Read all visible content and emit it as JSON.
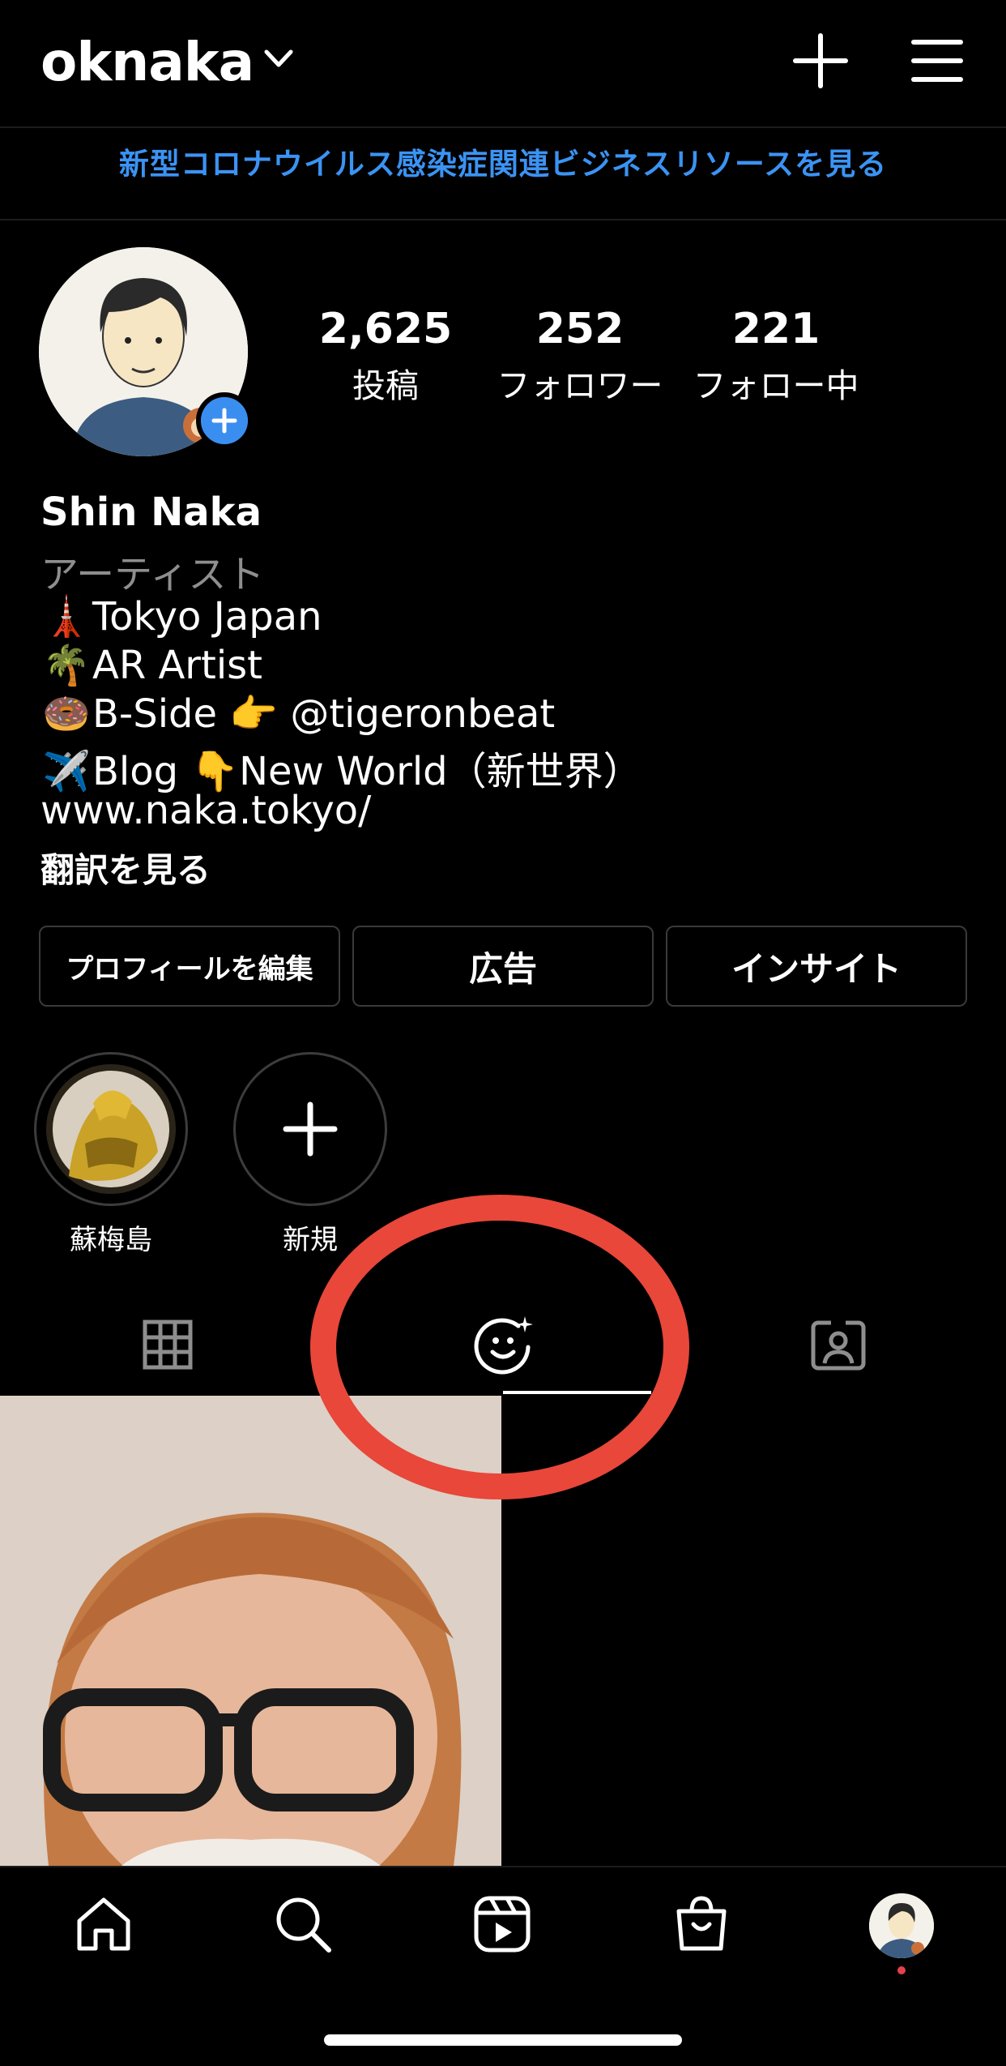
{
  "header": {
    "username": "oknaka",
    "banner": "新型コロナウイルス感染症関連ビジネスリソースを見る"
  },
  "stats": [
    {
      "value": "2,625",
      "label": "投稿"
    },
    {
      "value": "252",
      "label": "フォロワー"
    },
    {
      "value": "221",
      "label": "フォロー中"
    }
  ],
  "bio": {
    "name": "Shin Naka",
    "category": "アーティスト",
    "lines": [
      {
        "emoji": "🗼",
        "text": "Tokyo Japan"
      },
      {
        "emoji": "🌴",
        "text": "AR Artist"
      },
      {
        "emoji": "🍩",
        "text": "B-Side 👉 @tigeronbeat"
      },
      {
        "emoji": "✈️",
        "text": "Blog 👇New World（新世界）"
      }
    ],
    "website": "www.naka.tokyo/",
    "translate": "翻訳を見る"
  },
  "buttons": {
    "edit_profile": "プロフィールを編集",
    "ads": "広告",
    "insights": "インサイト"
  },
  "highlights": [
    {
      "label": "蘇梅島"
    },
    {
      "label": "新規"
    }
  ],
  "tabs": [
    {
      "icon": "grid-icon",
      "selected": false
    },
    {
      "icon": "effects-face-icon",
      "selected": true
    },
    {
      "icon": "tagged-portrait-icon",
      "selected": false
    }
  ],
  "nav": [
    "home-icon",
    "search-icon",
    "reels-icon",
    "shop-icon",
    "profile-avatar"
  ],
  "colors": {
    "accent_blue": "#3b93f3",
    "annotation_red": "#e8473a",
    "notification_dot": "#e4414b"
  }
}
